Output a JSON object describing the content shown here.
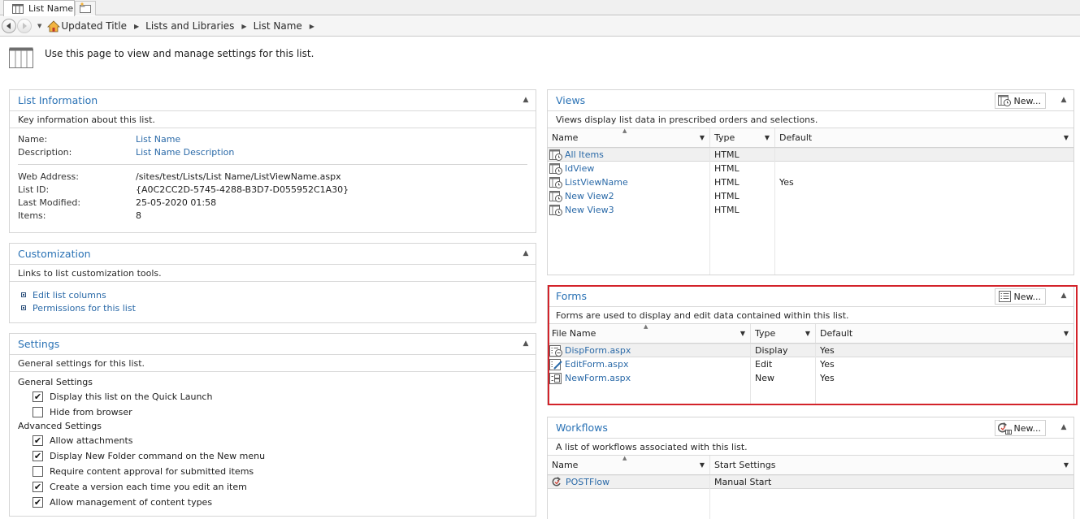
{
  "browser": {
    "tab_label": "List Name",
    "breadcrumb": [
      "Updated Title",
      "Lists and Libraries",
      "List Name"
    ]
  },
  "page": {
    "intro": "Use this page to view and manage settings for this list."
  },
  "list_information": {
    "title": "List Information",
    "description": "Key information about this list.",
    "fields_top": [
      {
        "label": "Name:",
        "value": "List Name"
      },
      {
        "label": "Description:",
        "value": "List Name Description"
      }
    ],
    "fields_bottom": [
      {
        "label": "Web Address:",
        "value": "/sites/test/Lists/List Name/ListViewName.aspx"
      },
      {
        "label": "List ID:",
        "value": "{A0C2CC2D-5745-4288-B3D7-D055952C1A30}"
      },
      {
        "label": "Last Modified:",
        "value": "25-05-2020 01:58"
      },
      {
        "label": "Items:",
        "value": "8"
      }
    ]
  },
  "customization": {
    "title": "Customization",
    "description": "Links to list customization tools.",
    "links": [
      "Edit list columns",
      "Permissions for this list"
    ]
  },
  "settings": {
    "title": "Settings",
    "description": "General settings for this list.",
    "general_label": "General Settings",
    "general": [
      {
        "label": "Display this list on the Quick Launch",
        "checked": true
      },
      {
        "label": "Hide from browser",
        "checked": false
      }
    ],
    "advanced_label": "Advanced Settings",
    "advanced": [
      {
        "label": "Allow attachments",
        "checked": true
      },
      {
        "label": "Display New Folder command on the New menu",
        "checked": true
      },
      {
        "label": "Require content approval for submitted items",
        "checked": false
      },
      {
        "label": "Create a version each time you edit an item",
        "checked": true
      },
      {
        "label": "Allow management of content types",
        "checked": true
      }
    ],
    "check_glyph": "✔"
  },
  "views": {
    "title": "Views",
    "new_label": "New...",
    "description": "Views display list data in prescribed orders and selections.",
    "columns": [
      "Name",
      "Type",
      "Default"
    ],
    "rows": [
      {
        "name": "All Items",
        "type": "HTML",
        "default": ""
      },
      {
        "name": "IdView",
        "type": "HTML",
        "default": ""
      },
      {
        "name": "ListViewName",
        "type": "HTML",
        "default": "Yes"
      },
      {
        "name": "New View2",
        "type": "HTML",
        "default": ""
      },
      {
        "name": "New View3",
        "type": "HTML",
        "default": ""
      }
    ]
  },
  "forms": {
    "title": "Forms",
    "new_label": "New...",
    "description": "Forms are used to display and edit data contained within this list.",
    "columns": [
      "File Name",
      "Type",
      "Default"
    ],
    "rows": [
      {
        "name": "DispForm.aspx",
        "type": "Display",
        "default": "Yes",
        "icon": "display-form-icon"
      },
      {
        "name": "EditForm.aspx",
        "type": "Edit",
        "default": "Yes",
        "icon": "edit-form-icon"
      },
      {
        "name": "NewForm.aspx",
        "type": "New",
        "default": "Yes",
        "icon": "new-form-icon"
      }
    ],
    "highlight_color": "#d3232a"
  },
  "workflows": {
    "title": "Workflows",
    "new_label": "New...",
    "description": "A list of workflows associated with this list.",
    "columns": [
      "Name",
      "Start Settings"
    ],
    "rows": [
      {
        "name": "POSTFlow",
        "start": "Manual Start"
      }
    ]
  },
  "colors": {
    "title_blue": "#2a72b5",
    "link_blue": "#2b6aa8",
    "border": "#d5d5d5"
  }
}
